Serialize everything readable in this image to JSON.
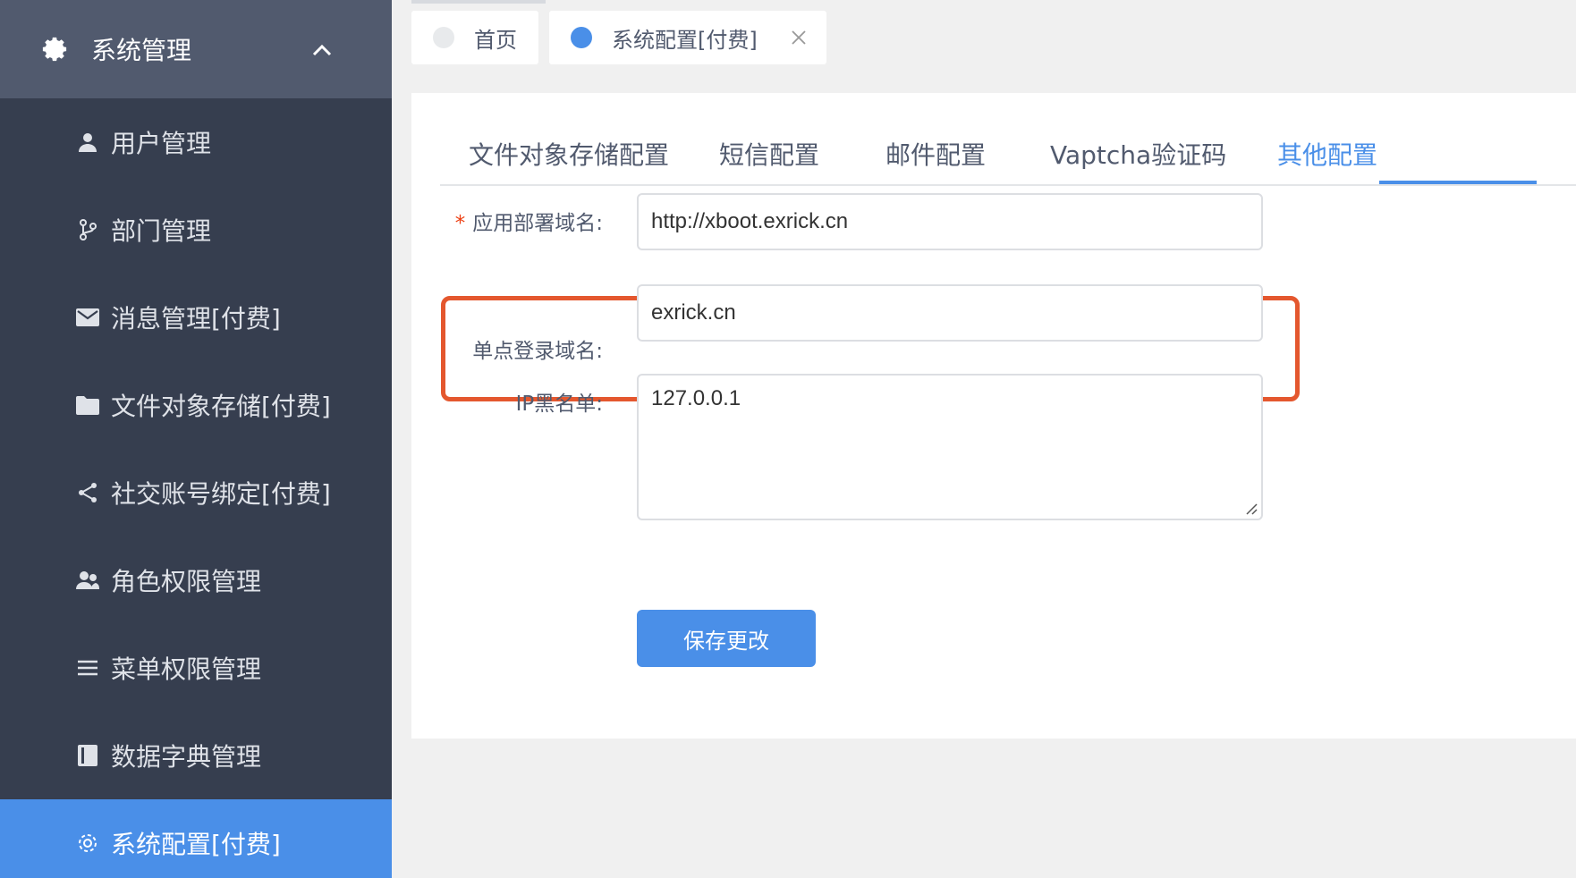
{
  "sidebar": {
    "header_label": "系统管理",
    "items": [
      {
        "label": "用户管理",
        "icon": "user-icon"
      },
      {
        "label": "部门管理",
        "icon": "branch-icon"
      },
      {
        "label": "消息管理[付费]",
        "icon": "mail-icon"
      },
      {
        "label": "文件对象存储[付费]",
        "icon": "folder-icon"
      },
      {
        "label": "社交账号绑定[付费]",
        "icon": "share-icon"
      },
      {
        "label": "角色权限管理",
        "icon": "users-icon"
      },
      {
        "label": "菜单权限管理",
        "icon": "list-icon"
      },
      {
        "label": "数据字典管理",
        "icon": "book-icon"
      },
      {
        "label": "系统配置[付费]",
        "icon": "gear-icon",
        "active": true
      }
    ]
  },
  "tabs": {
    "home_label": "首页",
    "current_label": "系统配置[付费]"
  },
  "subtabs": [
    {
      "label": "文件对象存储配置"
    },
    {
      "label": "短信配置"
    },
    {
      "label": "邮件配置"
    },
    {
      "label": "Vaptcha验证码"
    },
    {
      "label": "其他配置",
      "active": true
    }
  ],
  "form": {
    "app_domain_label": "应用部署域名:",
    "app_domain_value": "http://xboot.exrick.cn",
    "sso_domain_label": "单点登录域名:",
    "sso_domain_value": "exrick.cn",
    "ip_blacklist_label": "IP黑名单:",
    "ip_blacklist_value": "127.0.0.1",
    "required_mark": "*",
    "save_label": "保存更改"
  },
  "colors": {
    "sidebar_bg": "#363e4f",
    "sidebar_header_bg": "#515a6e",
    "accent": "#4a8fe8",
    "highlight": "#e4572e"
  }
}
